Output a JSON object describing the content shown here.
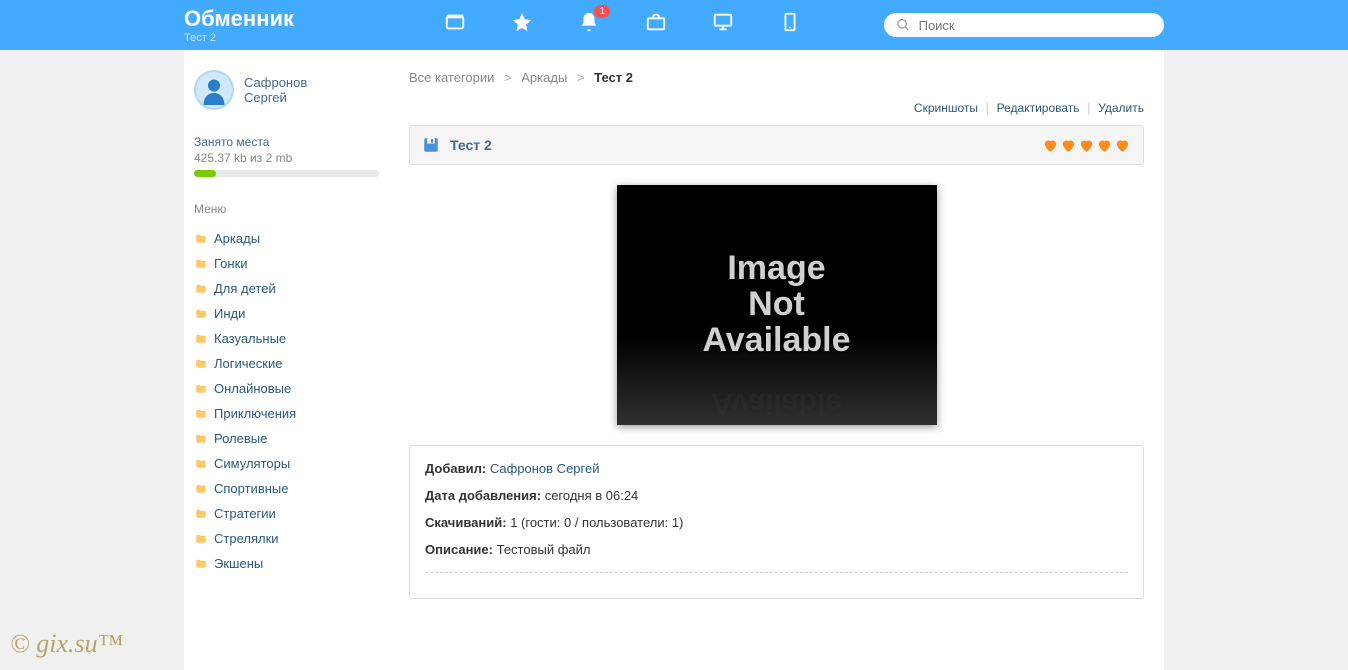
{
  "header": {
    "title": "Обменник",
    "subtitle": "Тест 2",
    "notification_badge": "1",
    "search_placeholder": "Поиск"
  },
  "sidebar": {
    "user_line1": "Сафронов",
    "user_line2": "Сергей",
    "storage_label": "Занято места",
    "storage_value": "425.37 kb из 2 mb",
    "menu_label": "Меню",
    "items": [
      {
        "label": "Аркады"
      },
      {
        "label": "Гонки"
      },
      {
        "label": "Для детей"
      },
      {
        "label": "Инди"
      },
      {
        "label": "Казуальные"
      },
      {
        "label": "Логические"
      },
      {
        "label": "Онлайновые"
      },
      {
        "label": "Приключения"
      },
      {
        "label": "Ролевые"
      },
      {
        "label": "Симуляторы"
      },
      {
        "label": "Спортивные"
      },
      {
        "label": "Стратегии"
      },
      {
        "label": "Стрелялки"
      },
      {
        "label": "Экшены"
      }
    ]
  },
  "breadcrumb": {
    "level0": "Все категории",
    "level1": "Аркады",
    "current": "Тест 2"
  },
  "actions": {
    "screenshots": "Скриншоты",
    "edit": "Редактировать",
    "delete": "Удалить"
  },
  "content": {
    "title": "Тест 2",
    "img_line1": "Image",
    "img_line2": "Not",
    "img_line3": "Available"
  },
  "details": {
    "added_by_label": "Добавил:",
    "added_by_value": "Сафронов Сергей",
    "date_label": "Дата добавления:",
    "date_value": "сегодня в 06:24",
    "downloads_label": "Скачиваний:",
    "downloads_value": "1 (гости: 0 / пользователи: 1)",
    "desc_label": "Описание:",
    "desc_value": "Тестовый файл"
  },
  "watermark": "© gix.su™"
}
